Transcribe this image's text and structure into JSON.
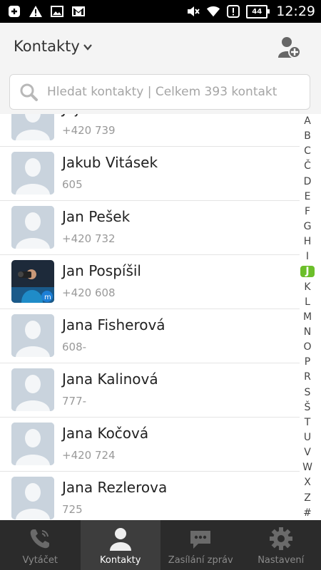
{
  "status_bar": {
    "time": "12:29",
    "battery": "44",
    "icons_left": [
      "notification-plus-icon",
      "warning-icon",
      "image-icon",
      "gmail-icon"
    ],
    "icons_right": [
      "mute-icon",
      "wifi-icon",
      "alert-icon",
      "battery-icon"
    ]
  },
  "header": {
    "title": "Kontakty",
    "add_contact_icon": "add-contact-icon"
  },
  "search": {
    "placeholder": "Hledat kontakty | Celkem 393 kontakt"
  },
  "contacts": [
    {
      "name": "Jaja Bambuchová",
      "phone": "+420 739",
      "avatar": "default"
    },
    {
      "name": "Jakub Vitásek",
      "phone": "605",
      "avatar": "default"
    },
    {
      "name": "Jan Pešek",
      "phone": "+420 732",
      "avatar": "default"
    },
    {
      "name": "Jan Pospíšil",
      "phone": "+420 608",
      "avatar": "photo"
    },
    {
      "name": "Jana Fisherová",
      "phone": "608-",
      "avatar": "default"
    },
    {
      "name": "Jana Kalinová",
      "phone": "777-",
      "avatar": "default"
    },
    {
      "name": "Jana Kočová",
      "phone": "+420 724",
      "avatar": "default"
    },
    {
      "name": "Jana Rezlerova",
      "phone": "725",
      "avatar": "default"
    }
  ],
  "index_letters": [
    "A",
    "B",
    "C",
    "Č",
    "D",
    "E",
    "F",
    "G",
    "H",
    "I",
    "J",
    "K",
    "L",
    "M",
    "N",
    "O",
    "P",
    "R",
    "S",
    "Š",
    "T",
    "U",
    "V",
    "W",
    "X",
    "Z",
    "#"
  ],
  "index_active": "J",
  "colors": {
    "accent": "#6cbf2a",
    "nav_bg": "#2b2b2b",
    "avatar_bg": "#c9d3dd"
  },
  "bottom_nav": [
    {
      "label": "Vytáčet",
      "icon": "phone-icon",
      "active": false
    },
    {
      "label": "Kontakty",
      "icon": "person-icon",
      "active": true
    },
    {
      "label": "Zasílání zpráv",
      "icon": "message-icon",
      "active": false
    },
    {
      "label": "Nastavení",
      "icon": "gear-icon",
      "active": false
    }
  ]
}
